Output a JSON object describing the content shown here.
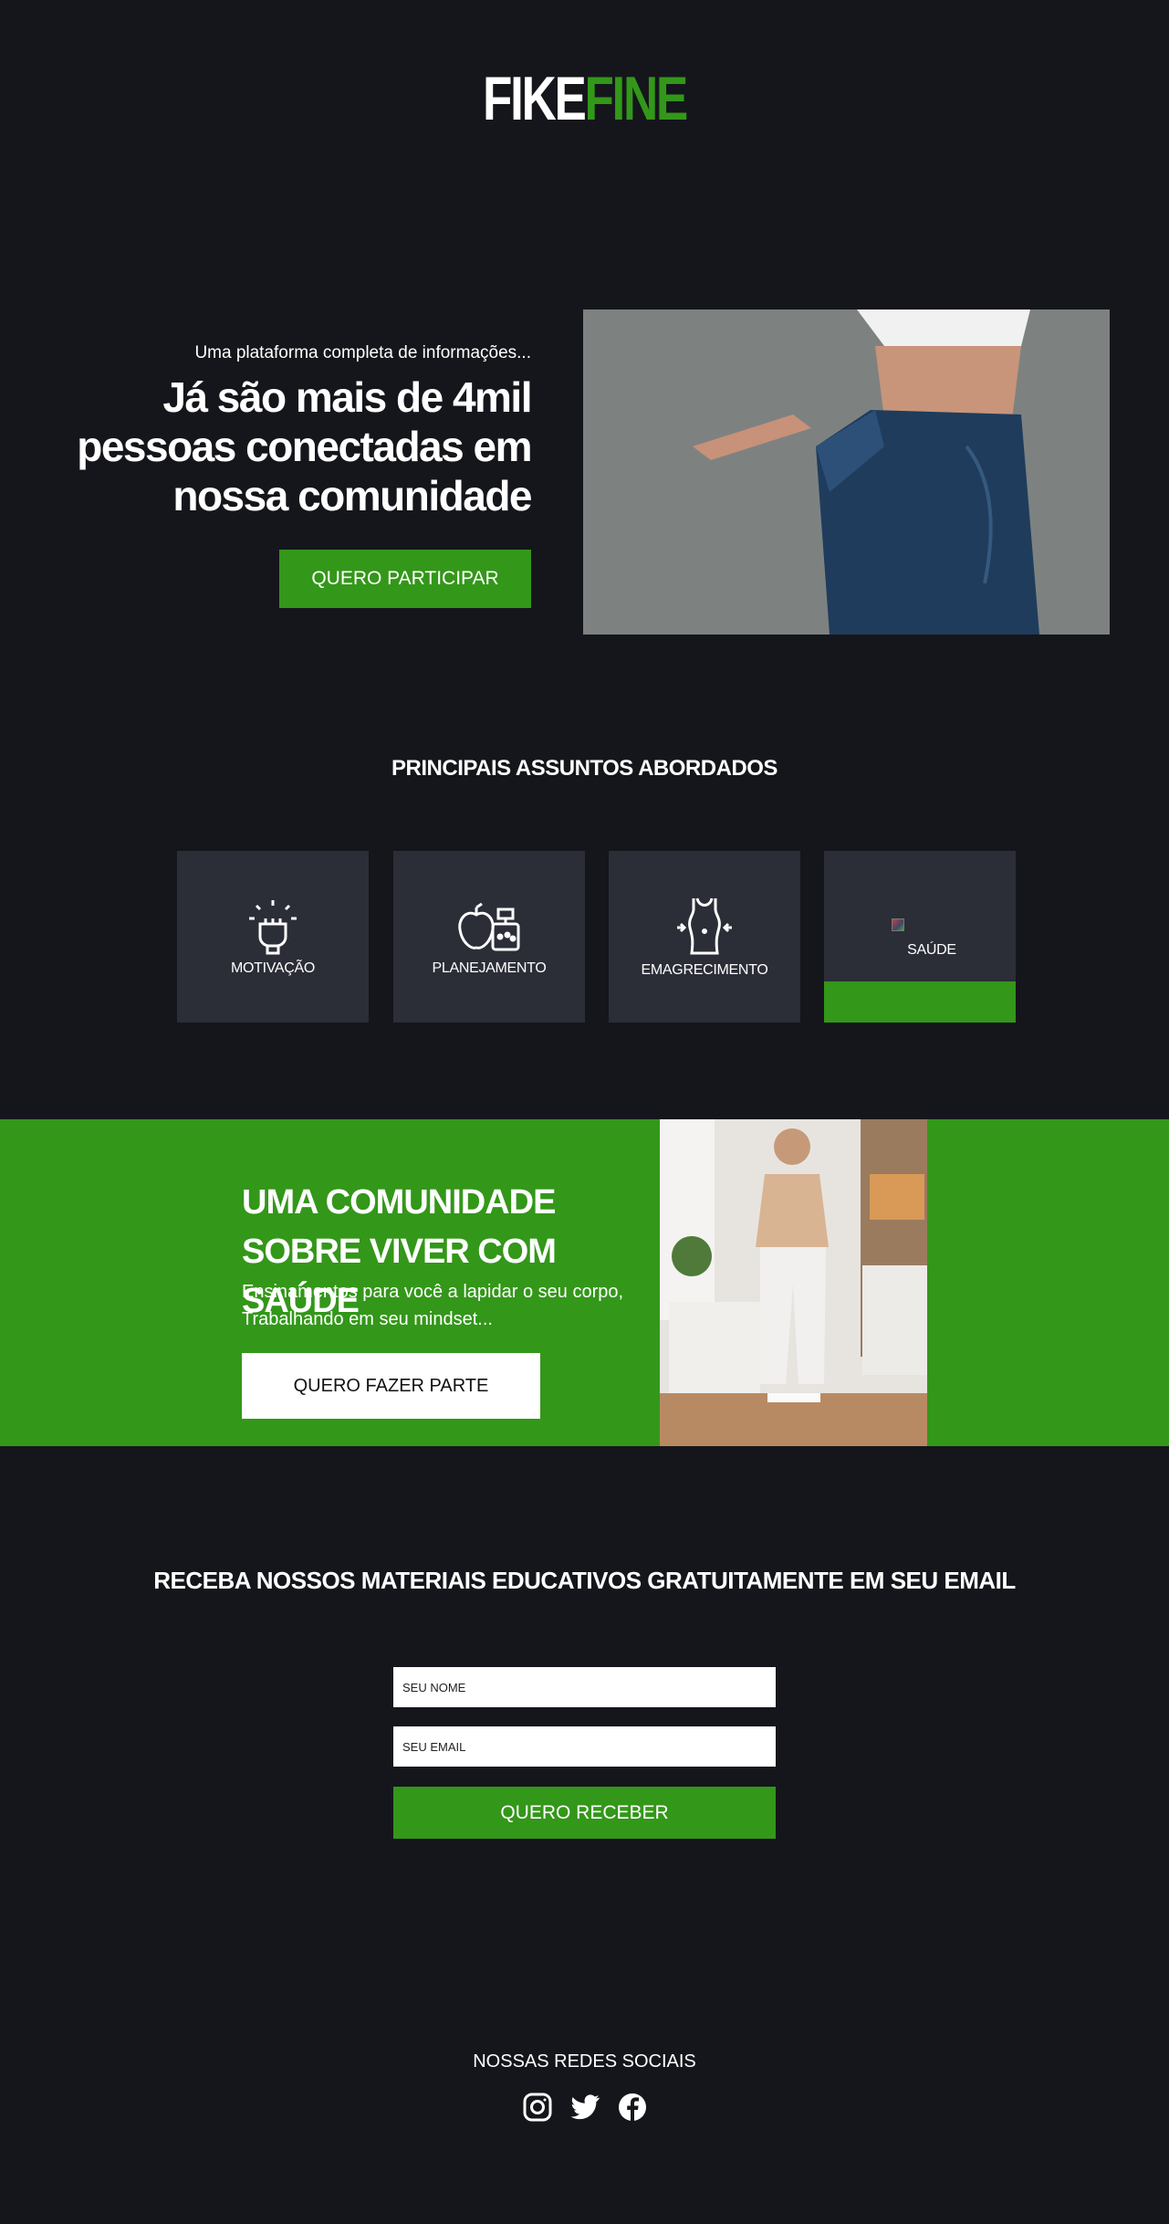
{
  "logo": {
    "part1": "FIKE",
    "part2": "FINE"
  },
  "hero": {
    "kicker": "Uma plataforma completa de informações...",
    "title": "Já são mais de 4mil pessoas conectadas em nossa comunidade",
    "button": "QUERO PARTICIPAR"
  },
  "topics": {
    "title": "PRINCIPAIS ASSUNTOS ABORDADOS",
    "items": [
      {
        "label": "MOTIVAÇÃO",
        "icon": "fist-icon"
      },
      {
        "label": "PLANEJAMENTO",
        "icon": "diet-scale-icon"
      },
      {
        "label": "EMAGRECIMENTO",
        "icon": "body-waist-icon"
      },
      {
        "label": "SAÚDE",
        "icon": "broken-image-icon"
      }
    ]
  },
  "community": {
    "title": "UMA COMUNIDADE SOBRE VIVER COM SAÚDE",
    "subtitle": "Ensinamentos para você a lapidar o seu corpo, Trabalhando em seu mindset...",
    "button": "QUERO FAZER PARTE"
  },
  "newsletter": {
    "title": "RECEBA NOSSOS MATERIAIS EDUCATIVOS GRATUITAMENTE EM SEU EMAIL",
    "name_placeholder": "SEU NOME",
    "email_placeholder": "SEU EMAIL",
    "button": "QUERO RECEBER"
  },
  "social": {
    "title": "NOSSAS REDES SOCIAIS",
    "icons": [
      "instagram-icon",
      "twitter-icon",
      "facebook-icon"
    ]
  },
  "colors": {
    "background": "#15161b",
    "accent": "#339719",
    "card": "#2b2d37"
  }
}
